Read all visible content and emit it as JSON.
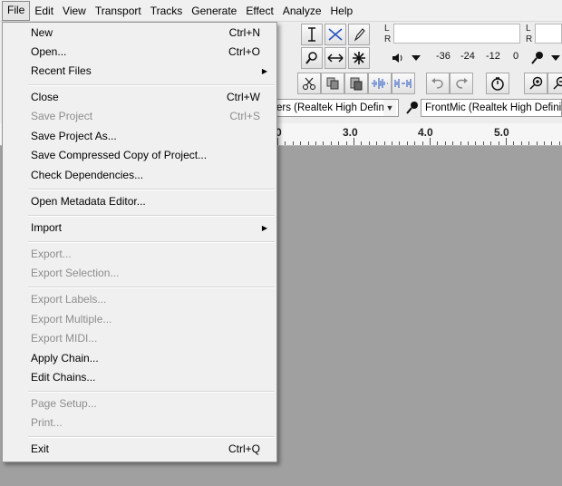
{
  "menubar": {
    "items": [
      "File",
      "Edit",
      "View",
      "Transport",
      "Tracks",
      "Generate",
      "Effect",
      "Analyze",
      "Help"
    ]
  },
  "file_menu": {
    "items": [
      {
        "label": "New",
        "shortcut": "Ctrl+N",
        "enabled": true
      },
      {
        "label": "Open...",
        "shortcut": "Ctrl+O",
        "enabled": true
      },
      {
        "label": "Recent Files",
        "shortcut": "",
        "enabled": true,
        "submenu": true
      },
      {
        "label": "Close",
        "shortcut": "Ctrl+W",
        "enabled": true
      },
      {
        "label": "Save Project",
        "shortcut": "Ctrl+S",
        "enabled": false
      },
      {
        "label": "Save Project As...",
        "shortcut": "",
        "enabled": true
      },
      {
        "label": "Save Compressed Copy of Project...",
        "shortcut": "",
        "enabled": true
      },
      {
        "label": "Check Dependencies...",
        "shortcut": "",
        "enabled": true
      },
      {
        "label": "Open Metadata Editor...",
        "shortcut": "",
        "enabled": true
      },
      {
        "label": "Import",
        "shortcut": "",
        "enabled": true,
        "submenu": true
      },
      {
        "label": "Export...",
        "shortcut": "",
        "enabled": false
      },
      {
        "label": "Export Selection...",
        "shortcut": "",
        "enabled": false
      },
      {
        "label": "Export Labels...",
        "shortcut": "",
        "enabled": false
      },
      {
        "label": "Export Multiple...",
        "shortcut": "",
        "enabled": false
      },
      {
        "label": "Export MIDI...",
        "shortcut": "",
        "enabled": false
      },
      {
        "label": "Apply Chain...",
        "shortcut": "",
        "enabled": true
      },
      {
        "label": "Edit Chains...",
        "shortcut": "",
        "enabled": true
      },
      {
        "label": "Page Setup...",
        "shortcut": "",
        "enabled": false
      },
      {
        "label": "Print...",
        "shortcut": "",
        "enabled": false
      },
      {
        "label": "Exit",
        "shortcut": "Ctrl+Q",
        "enabled": true
      }
    ]
  },
  "meter": {
    "left_channel": "L",
    "right_channel": "R",
    "scale": [
      "-36",
      "-24",
      "-12",
      "0"
    ]
  },
  "devices": {
    "output_device": "ers (Realtek High Definit",
    "input_device": "FrontMic (Realtek High Definiti"
  },
  "ruler": {
    "labels": [
      "0",
      "3.0",
      "4.0",
      "5.0"
    ]
  },
  "colors": {
    "menu_bg": "#f0f0f0",
    "disabled_text": "#8d8d8d",
    "track_bg": "#a0a0a0"
  }
}
